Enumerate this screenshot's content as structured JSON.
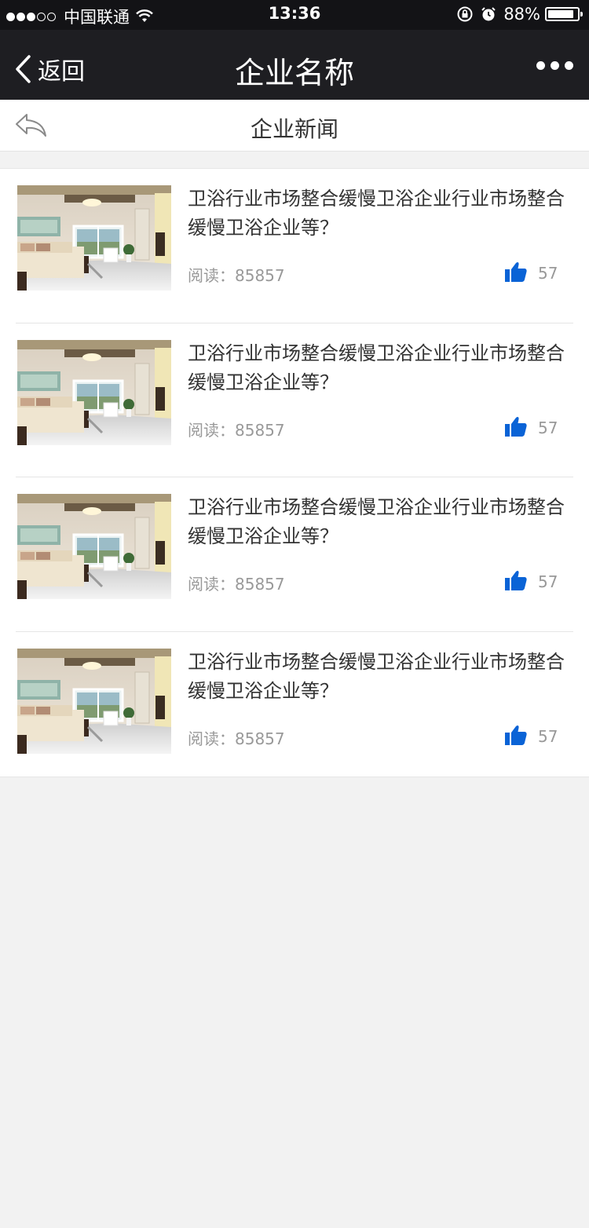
{
  "status_bar": {
    "carrier": "中国联通",
    "time": "13:36",
    "battery": "88%",
    "battery_level": 0.88,
    "signal_bars_filled": 3,
    "signal_bars_total": 5
  },
  "nav": {
    "back_label": "返回",
    "title": "企业名称"
  },
  "sub_header": {
    "title": "企业新闻"
  },
  "colors": {
    "status_bg": "#131316",
    "nav_bg": "#1e1e22",
    "like_icon": "#0a63d6",
    "page_bg": "#f2f2f2"
  },
  "icons": {
    "back": "chevron-left-icon",
    "more": "more-dots-icon",
    "sub_back": "reply-arrow-icon",
    "like": "thumbs-up-icon",
    "wifi": "wifi-icon",
    "rotation_lock": "rotation-lock-icon",
    "alarm": "alarm-icon"
  },
  "news": [
    {
      "title": "卫浴行业市场整合缓慢卫浴企业行业市场整合缓慢卫浴企业等？",
      "read_label": "阅读：",
      "read_count": "85857",
      "likes": "57"
    },
    {
      "title": "卫浴行业市场整合缓慢卫浴企业行业市场整合缓慢卫浴企业等？",
      "read_label": "阅读：",
      "read_count": "85857",
      "likes": "57"
    },
    {
      "title": "卫浴行业市场整合缓慢卫浴企业行业市场整合缓慢卫浴企业等？",
      "read_label": "阅读：",
      "read_count": "85857",
      "likes": "57"
    },
    {
      "title": "卫浴行业市场整合缓慢卫浴企业行业市场整合缓慢卫浴企业等？",
      "read_label": "阅读：",
      "read_count": "85857",
      "likes": "57"
    }
  ]
}
